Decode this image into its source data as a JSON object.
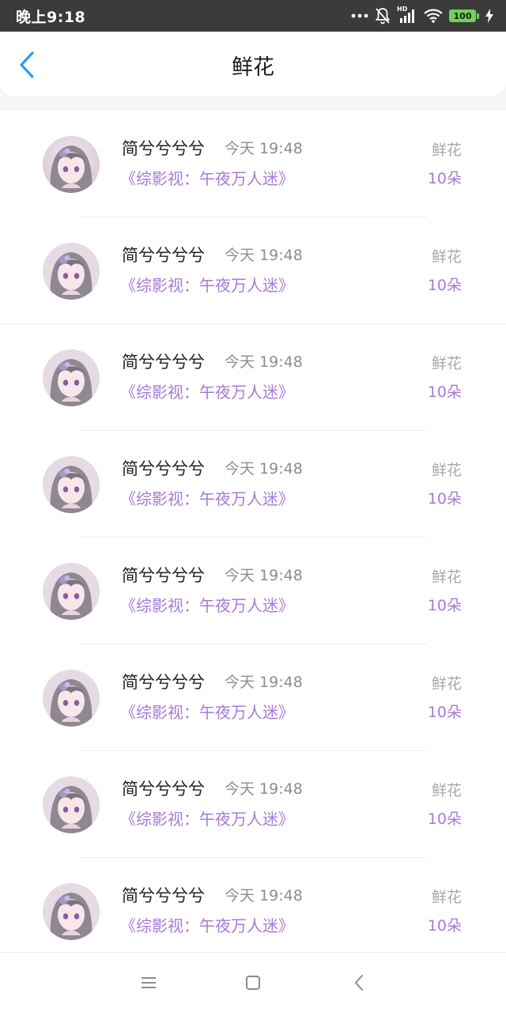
{
  "status_bar": {
    "time": "晚上9:18",
    "battery": "100",
    "network_label": "HD",
    "icons": [
      "more-dots-icon",
      "bell-muted-icon",
      "signal-icon",
      "wifi-icon",
      "battery-icon",
      "charging-icon"
    ]
  },
  "header": {
    "title": "鲜花",
    "back_icon": "chevron-left-icon"
  },
  "colors": {
    "accent_purple": "#a77ad6",
    "back_blue": "#2f9bf0",
    "battery_green": "#6fd256",
    "status_bar_bg": "#3b3b3b"
  },
  "list": {
    "items": [
      {
        "name": "简兮兮兮兮",
        "time": "今天 19:48",
        "book": "《综影视：午夜万人迷》",
        "gift": "鲜花",
        "count": "10朵"
      },
      {
        "name": "简兮兮兮兮",
        "time": "今天 19:48",
        "book": "《综影视：午夜万人迷》",
        "gift": "鲜花",
        "count": "10朵"
      },
      {
        "name": "简兮兮兮兮",
        "time": "今天 19:48",
        "book": "《综影视：午夜万人迷》",
        "gift": "鲜花",
        "count": "10朵"
      },
      {
        "name": "简兮兮兮兮",
        "time": "今天 19:48",
        "book": "《综影视：午夜万人迷》",
        "gift": "鲜花",
        "count": "10朵"
      },
      {
        "name": "简兮兮兮兮",
        "time": "今天 19:48",
        "book": "《综影视：午夜万人迷》",
        "gift": "鲜花",
        "count": "10朵"
      },
      {
        "name": "简兮兮兮兮",
        "time": "今天 19:48",
        "book": "《综影视：午夜万人迷》",
        "gift": "鲜花",
        "count": "10朵"
      },
      {
        "name": "简兮兮兮兮",
        "time": "今天 19:48",
        "book": "《综影视：午夜万人迷》",
        "gift": "鲜花",
        "count": "10朵"
      },
      {
        "name": "简兮兮兮兮",
        "time": "今天 19:48",
        "book": "《综影视：午夜万人迷》",
        "gift": "鲜花",
        "count": "10朵"
      }
    ]
  },
  "bottom_nav": {
    "icons": [
      "menu-icon",
      "home-square-icon",
      "back-triangle-icon"
    ]
  }
}
